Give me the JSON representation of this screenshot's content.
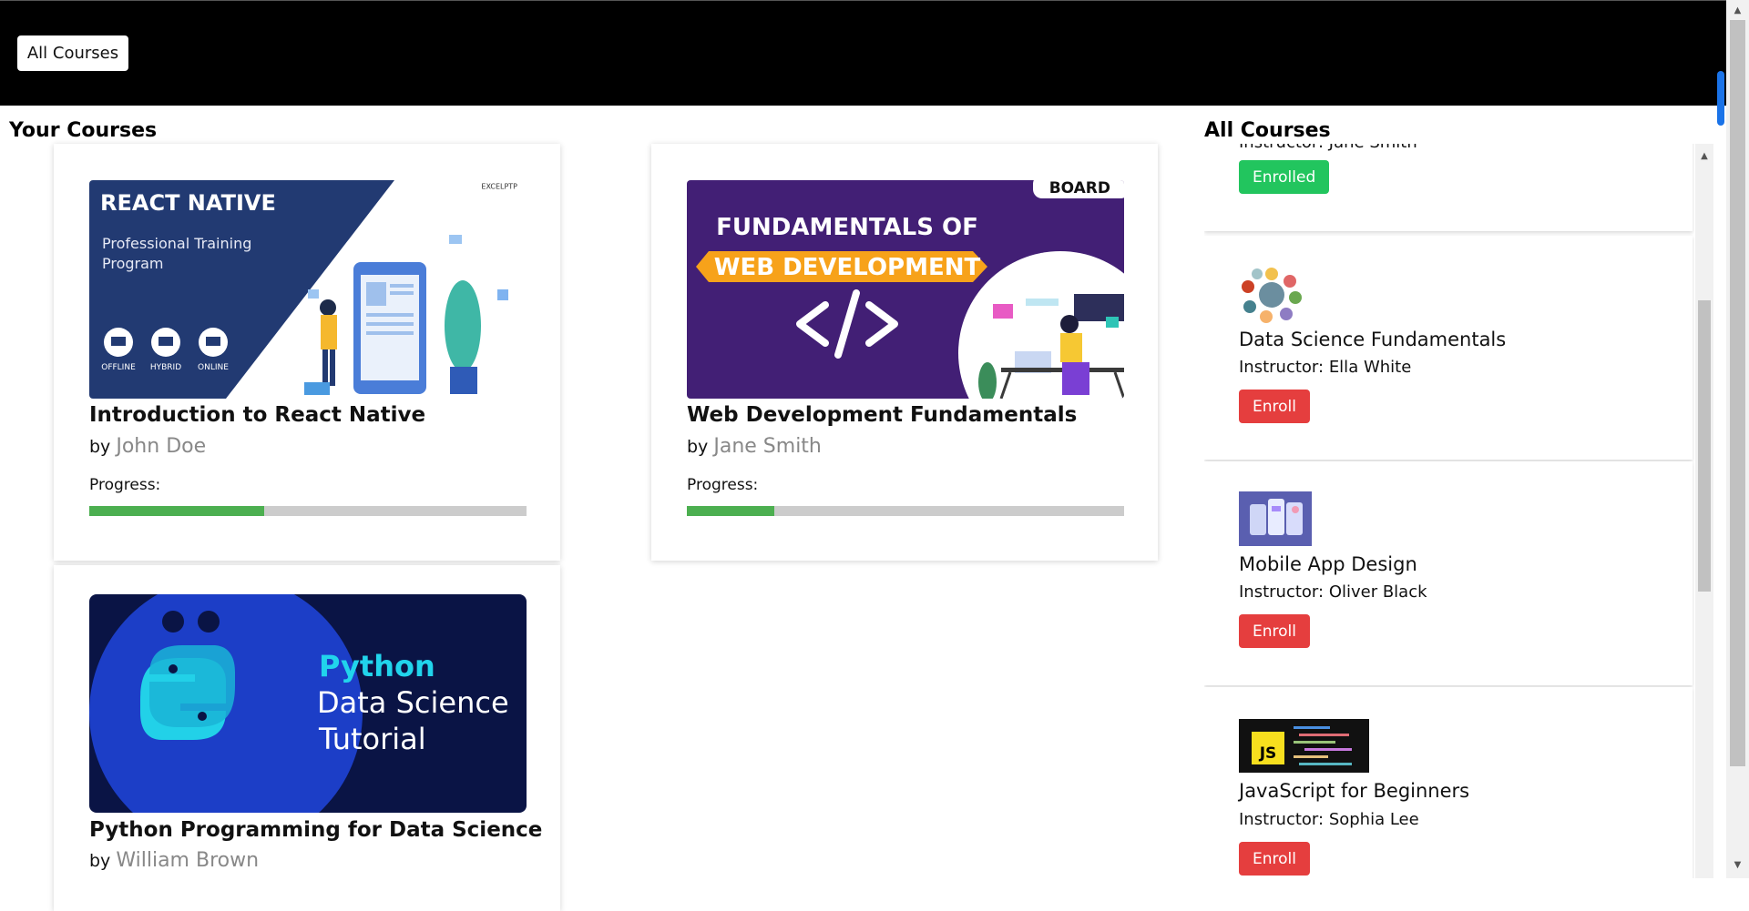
{
  "nav": {
    "all_courses_button": "All Courses"
  },
  "your_courses": {
    "heading": "Your Courses",
    "progress_label": "Progress:",
    "by_label": "by",
    "courses": [
      {
        "title": "Introduction to React Native",
        "instructor": "John Doe",
        "progress": 0.4,
        "banner": {
          "heading": "REACT NATIVE",
          "line1": "Professional Training",
          "line2": "Program",
          "modes": [
            "OFFLINE",
            "HYBRID",
            "ONLINE"
          ],
          "brand": "EXCELPTP"
        }
      },
      {
        "title": "Web Development Fundamentals",
        "instructor": "Jane Smith",
        "progress": 0.2,
        "banner": {
          "line1": "FUNDAMENTALS OF",
          "line2": "WEB DEVELOPMENT",
          "brand": "BOARD"
        }
      },
      {
        "title": "Python Programming for Data Science",
        "instructor": "William Brown",
        "banner": {
          "line1": "Python",
          "line2": "Data Science",
          "line3": "Tutorial"
        }
      }
    ]
  },
  "all_courses": {
    "heading": "All Courses",
    "instructor_prefix": "Instructor:",
    "items": [
      {
        "partial_text": "Instructor: Jane Smith",
        "button": "Enrolled",
        "status": "enrolled"
      },
      {
        "title": "Data Science Fundamentals",
        "instructor": "Ella White",
        "button": "Enroll",
        "status": "not-enrolled"
      },
      {
        "title": "Mobile App Design",
        "instructor": "Oliver Black",
        "button": "Enroll",
        "status": "not-enrolled"
      },
      {
        "title": "JavaScript for Beginners",
        "instructor": "Sophia Lee",
        "button": "Enroll",
        "status": "not-enrolled",
        "thumb_text": "JS"
      }
    ]
  },
  "colors": {
    "topbar": "#000000",
    "progress_fill": "#4caf50",
    "progress_track": "#cccccc",
    "enroll": "#e53e3e",
    "enrolled": "#22c55e",
    "instructor_name": "#888888"
  }
}
